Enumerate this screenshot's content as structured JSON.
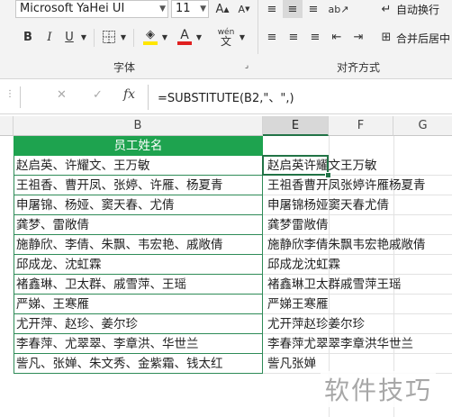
{
  "ribbon": {
    "font_name": "Microsoft YaHei UI",
    "font_size": "11",
    "font_group_label": "字体",
    "align_group_label": "对齐方式",
    "wrap_text_label": "自动换行",
    "merge_center_label": "合并后居中",
    "bold": "B",
    "italic": "I",
    "underline": "U",
    "wen_label": "wén\n文",
    "font_color": "#e02020",
    "fill_color": "#ffe600"
  },
  "formula_bar": {
    "cancel": "✕",
    "confirm": "✓",
    "fx": "fx",
    "formula": "=SUBSTITUTE(B2,\"、\",)"
  },
  "columns": {
    "B": "B",
    "E": "E",
    "F": "F",
    "G": "G"
  },
  "header_cell": "员工姓名",
  "rows_b": [
    "赵启英、许耀文、王万敏",
    "王祖香、曹开凤、张婷、许雁、杨夏青",
    "申屠锦、杨娅、窦天春、尤倩",
    "龚梦、雷敞倩",
    "施静欣、李倩、朱飘、韦宏艳、戚敞倩",
    "邱成龙、沈虹霖",
    "褚鑫琳、卫太群、戚雪萍、王瑶",
    "严娣、王寒雁",
    "尤开萍、赵珍、姜尔珍",
    "李春萍、尤翠翠、李章洪、华世兰",
    "訾凡、张婵、朱文秀、金紫霜、钱太红"
  ],
  "rows_e": [
    "赵启英许耀文王万敏",
    "王祖香曹开凤张婷许雁杨夏青",
    "申屠锦杨娅窦天春尤倩",
    "龚梦雷敞倩",
    "施静欣李倩朱飘韦宏艳戚敞倩",
    "邱成龙沈虹霖",
    "褚鑫琳卫太群戚雪萍王瑶",
    "严娣王寒雁",
    "尤开萍赵珍姜尔珍",
    "李春萍尤翠翠李章洪华世兰",
    "訾凡张婵"
  ],
  "watermark": "软件技巧",
  "colors": {
    "header_fill": "#1ea34f",
    "accent": "#217346"
  }
}
